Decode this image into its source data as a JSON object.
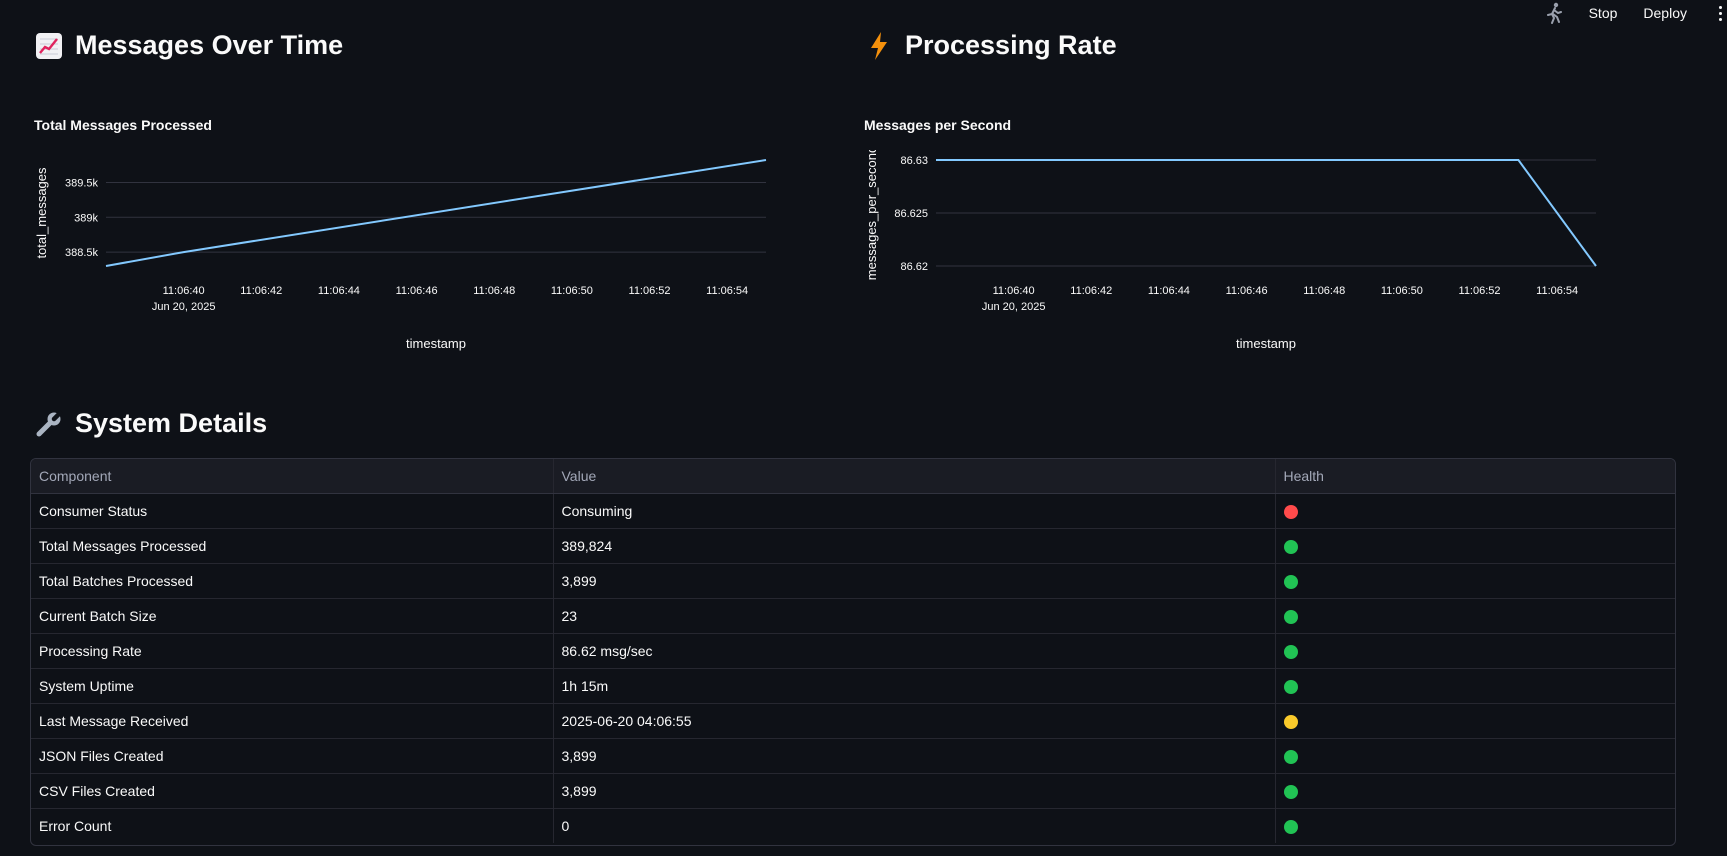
{
  "toolbar": {
    "stop_label": "Stop",
    "deploy_label": "Deploy"
  },
  "sections": {
    "messages": {
      "title": "Messages Over Time",
      "icon": "chart-increasing-icon"
    },
    "rate": {
      "title": "Processing Rate",
      "icon": "lightning-icon"
    },
    "details": {
      "title": "System Details",
      "icon": "wrench-icon"
    }
  },
  "chart_data": [
    {
      "type": "line",
      "title": "Total Messages Processed",
      "xlabel": "timestamp",
      "ylabel": "total_messages",
      "x": [
        "2025-06-20 11:06:38",
        "2025-06-20 11:06:40",
        "2025-06-20 11:06:55"
      ],
      "y": [
        388300,
        388500,
        389824
      ],
      "x_ticks": [
        "11:06:40",
        "11:06:42",
        "11:06:44",
        "11:06:46",
        "11:06:48",
        "11:06:50",
        "11:06:52",
        "11:06:54"
      ],
      "x_tick_sublabel": "Jun 20, 2025",
      "y_ticks": [
        "388.5k",
        "389k",
        "389.5k"
      ],
      "ylim": [
        388300,
        389824
      ],
      "grid": true,
      "color": "#83c9ff"
    },
    {
      "type": "line",
      "title": "Messages per Second",
      "xlabel": "timestamp",
      "ylabel": "messages_per_second",
      "x": [
        "2025-06-20 11:06:38",
        "2025-06-20 11:06:53",
        "2025-06-20 11:06:55"
      ],
      "y": [
        86.63,
        86.63,
        86.62
      ],
      "x_ticks": [
        "11:06:40",
        "11:06:42",
        "11:06:44",
        "11:06:46",
        "11:06:48",
        "11:06:50",
        "11:06:52",
        "11:06:54"
      ],
      "x_tick_sublabel": "Jun 20, 2025",
      "y_ticks": [
        "86.62",
        "86.625",
        "86.63"
      ],
      "ylim": [
        86.62,
        86.63
      ],
      "grid": true,
      "color": "#83c9ff"
    }
  ],
  "table": {
    "headers": [
      "Component",
      "Value",
      "Health"
    ],
    "rows": [
      {
        "component": "Consumer Status",
        "value": "Consuming",
        "health": "#ff4b4b"
      },
      {
        "component": "Total Messages Processed",
        "value": "389,824",
        "health": "#21c354"
      },
      {
        "component": "Total Batches Processed",
        "value": "3,899",
        "health": "#21c354"
      },
      {
        "component": "Current Batch Size",
        "value": "23",
        "health": "#21c354"
      },
      {
        "component": "Processing Rate",
        "value": "86.62 msg/sec",
        "health": "#21c354"
      },
      {
        "component": "System Uptime",
        "value": "1h 15m",
        "health": "#21c354"
      },
      {
        "component": "Last Message Received",
        "value": "2025-06-20 04:06:55",
        "health": "#faca2b"
      },
      {
        "component": "JSON Files Created",
        "value": "3,899",
        "health": "#21c354"
      },
      {
        "component": "CSV Files Created",
        "value": "3,899",
        "health": "#21c354"
      },
      {
        "component": "Error Count",
        "value": "0",
        "health": "#21c354"
      }
    ]
  }
}
